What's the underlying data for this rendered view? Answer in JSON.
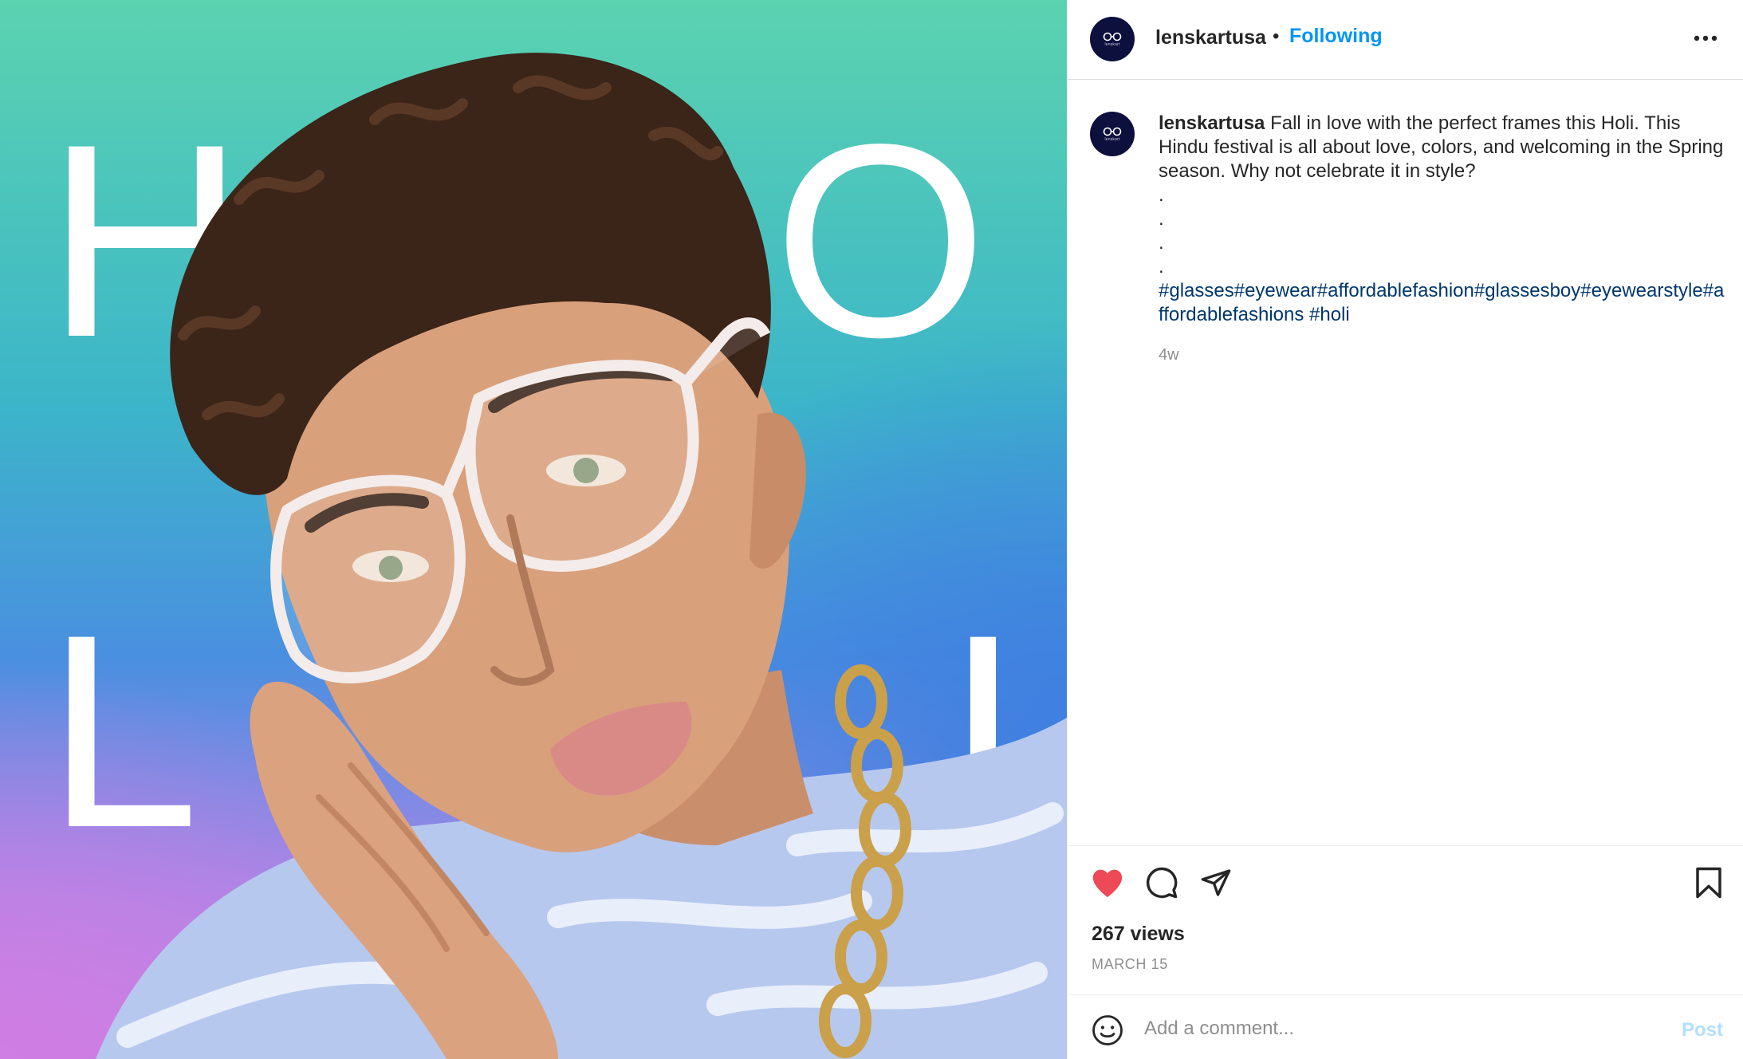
{
  "media": {
    "letters": [
      "H",
      "O",
      "L",
      "I"
    ]
  },
  "header": {
    "username": "lenskartusa",
    "separator": "•",
    "follow_label": "Following",
    "avatar_brand": "lenskart",
    "more_icon": "more-horizontal-icon"
  },
  "caption": {
    "username": "lenskartusa",
    "text": "Fall in love with the perfect frames this Holi. This Hindu festival is all about love, colors, and welcoming in the Spring season. Why not celebrate it in style?",
    "dots": [
      ".",
      ".",
      ".",
      "."
    ],
    "hashtags": [
      "#glasses",
      "#eyewear",
      "#affordablefashion",
      "#glassesboy",
      "#eyewearstyle",
      "#affordablefashions",
      " #holi"
    ],
    "time_ago": "4w"
  },
  "actions": {
    "like_icon": "heart-filled-icon",
    "comment_icon": "comment-icon",
    "share_icon": "paper-plane-icon",
    "save_icon": "bookmark-icon",
    "like_color": "#ed4956",
    "views": "267 views",
    "date": "MARCH 15"
  },
  "comment_box": {
    "emoji_icon": "emoji-icon",
    "placeholder": "Add a comment...",
    "post_label": "Post"
  },
  "colors": {
    "accent": "#0095f6",
    "hashtag": "#00376b",
    "post_disabled": "#b2dffc"
  }
}
